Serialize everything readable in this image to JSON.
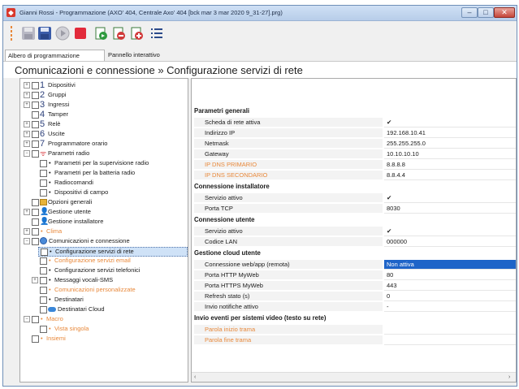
{
  "window": {
    "title": "Gianni Rossi - Programmazione (AXO' 404, Centrale Axo' 404 [bck mar 3 mar 2020 9_31-27].prg)",
    "controls": {
      "minimize": "–",
      "maximize": "□",
      "close": "✕"
    }
  },
  "toolbar": {
    "icons": [
      "separator-icon",
      "save-as-icon",
      "save-icon",
      "play-icon",
      "stop-icon",
      "read-icon",
      "write-icon",
      "write-all-icon",
      "list-icon"
    ]
  },
  "tabs": [
    {
      "label": "Albero di programmazione"
    },
    {
      "label": "Pannello interattivo"
    }
  ],
  "header": {
    "title": "Comunicazioni e connessione » Configurazione servizi di rete"
  },
  "tree": {
    "items": [
      {
        "num": "1",
        "label": "Dispositivi",
        "exp": "+"
      },
      {
        "num": "2",
        "label": "Gruppi",
        "exp": "+"
      },
      {
        "num": "3",
        "label": "Ingressi",
        "exp": "+"
      },
      {
        "num": "4",
        "label": "Tamper",
        "exp": ""
      },
      {
        "num": "5",
        "label": "Relè",
        "exp": "+"
      },
      {
        "num": "6",
        "label": "Uscite",
        "exp": "+"
      },
      {
        "num": "7",
        "label": "Programmatore orario",
        "exp": "+"
      },
      {
        "label": "Parametri radio",
        "exp": "-"
      },
      {
        "label": "Parametri per la supervisione radio"
      },
      {
        "label": "Parametri per la batteria radio"
      },
      {
        "label": "Radiocomandi"
      },
      {
        "label": "Dispositivi di campo"
      },
      {
        "label": "Opzioni generali"
      },
      {
        "label": "Gestione utente",
        "exp": "+"
      },
      {
        "label": "Gestione installatore"
      },
      {
        "label": "Clima",
        "exp": "+"
      },
      {
        "label": "Comunicazioni e connessione",
        "exp": "-"
      },
      {
        "label": "Configurazione servizi di rete"
      },
      {
        "label": "Configurazione servizi email"
      },
      {
        "label": "Configurazione servizi telefonici"
      },
      {
        "label": "Messaggi vocali-SMS",
        "exp": "+"
      },
      {
        "label": "Comunicazioni personalizzate"
      },
      {
        "label": "Destinatari"
      },
      {
        "label": "Destinatari Cloud"
      },
      {
        "label": "Macro",
        "exp": "-"
      },
      {
        "label": "Vista singola"
      },
      {
        "label": "Insiemi"
      }
    ]
  },
  "panel": {
    "sections": [
      {
        "title": "Parametri generali",
        "rows": [
          {
            "key": "Scheda di rete attiva",
            "value": "✔"
          },
          {
            "key": "Indirizzo IP",
            "value": "192.168.10.41"
          },
          {
            "key": "Netmask",
            "value": "255.255.255.0"
          },
          {
            "key": "Gateway",
            "value": "10.10.10.10"
          },
          {
            "key": "IP DNS PRIMARIO",
            "value": "8.8.8.8"
          },
          {
            "key": "IP DNS SECONDARIO",
            "value": "8.8.4.4"
          }
        ]
      },
      {
        "title": "Connessione installatore",
        "rows": [
          {
            "key": "Servizio attivo",
            "value": "✔"
          },
          {
            "key": "Porta TCP",
            "value": "8030"
          }
        ]
      },
      {
        "title": "Connessione utente",
        "rows": [
          {
            "key": "Servizio attivo",
            "value": "✔"
          },
          {
            "key": "Codice LAN",
            "value": "000000"
          }
        ]
      },
      {
        "title": "Gestione cloud utente",
        "rows": [
          {
            "key": "Connessione web/app (remota)",
            "value": "Non attiva"
          },
          {
            "key": "Porta HTTP MyWeb",
            "value": "80"
          },
          {
            "key": "Porta HTTPS MyWeb",
            "value": "443"
          },
          {
            "key": "Refresh stato (s)",
            "value": "0"
          },
          {
            "key": "Invio notifiche attivo",
            "value": "-"
          }
        ]
      },
      {
        "title": "Invio eventi per sistemi video (testo su rete)",
        "rows": [
          {
            "key": "Parola inizio trama",
            "value": ""
          },
          {
            "key": "Parola fine trama",
            "value": ""
          }
        ]
      }
    ],
    "scroll": {
      "left": "‹",
      "right": "›"
    }
  },
  "colors": {
    "accent_orange": "#e8883a",
    "selection_blue": "#1e64c8"
  }
}
